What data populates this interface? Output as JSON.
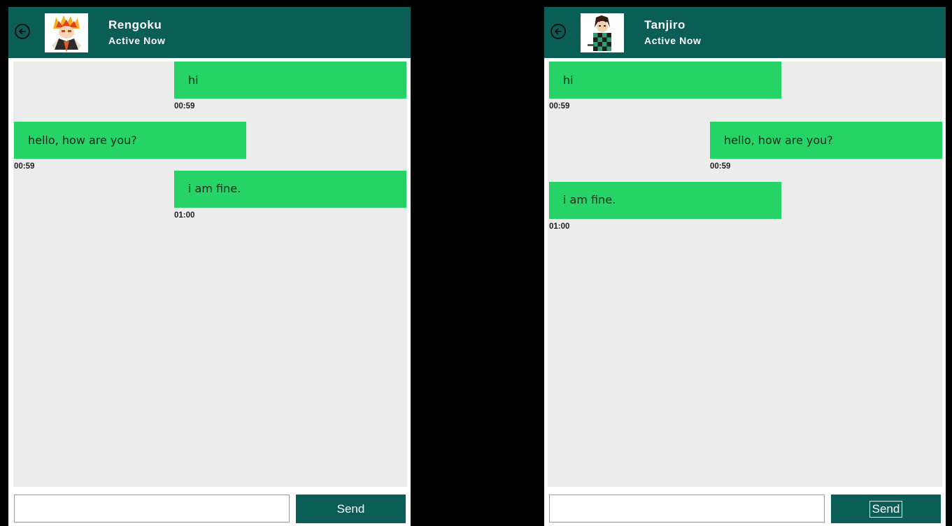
{
  "chats": [
    {
      "contact_name": "Rengoku",
      "status": "Active Now",
      "avatar": "rengoku-avatar",
      "messages": [
        {
          "text": "hi",
          "time": "00:59",
          "side": "sent"
        },
        {
          "text": "hello, how are you?",
          "time": "00:59",
          "side": "received"
        },
        {
          "text": "i am fine.",
          "time": "01:00",
          "side": "sent"
        }
      ],
      "input_value": "",
      "send_label": "Send"
    },
    {
      "contact_name": "Tanjiro",
      "status": "Active Now",
      "avatar": "tanjiro-avatar",
      "messages": [
        {
          "text": "hi",
          "time": "00:59",
          "side": "received"
        },
        {
          "text": "hello, how are you?",
          "time": "00:59",
          "side": "sent"
        },
        {
          "text": "i am fine.",
          "time": "01:00",
          "side": "received"
        }
      ],
      "input_value": "",
      "send_label": "Send"
    }
  ],
  "colors": {
    "header": "#0b5e55",
    "bubble": "#25d366",
    "chat_bg": "#ececec",
    "backdrop": "#000000"
  },
  "icons": {
    "back": "back-arrow-icon"
  }
}
